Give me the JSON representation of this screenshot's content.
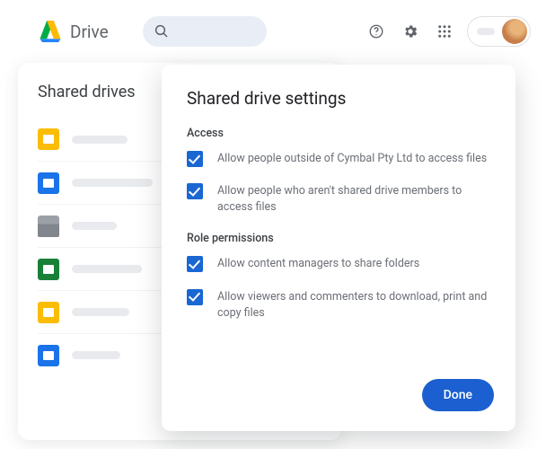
{
  "header": {
    "product": "Drive",
    "search_placeholder": "",
    "icons": {
      "help": "help-icon",
      "settings": "gear-icon",
      "apps": "apps-icon"
    }
  },
  "listPanel": {
    "title": "Shared drives",
    "items": [
      {
        "type": "folder-yellow"
      },
      {
        "type": "doc-blue"
      },
      {
        "type": "folder-gray"
      },
      {
        "type": "sheet-green"
      },
      {
        "type": "folder-yellow"
      },
      {
        "type": "doc-blue"
      }
    ]
  },
  "dialog": {
    "title": "Shared drive settings",
    "sections": {
      "access": {
        "label": "Access",
        "options": [
          {
            "checked": true,
            "text": "Allow people outside of Cymbal Pty Ltd to access files"
          },
          {
            "checked": true,
            "text": "Allow people who aren't shared drive members to access files"
          }
        ]
      },
      "roles": {
        "label": "Role permissions",
        "options": [
          {
            "checked": true,
            "text": "Allow content managers to share folders"
          },
          {
            "checked": true,
            "text": "Allow viewers and commenters to download, print and copy files"
          }
        ]
      }
    },
    "done": "Done"
  }
}
